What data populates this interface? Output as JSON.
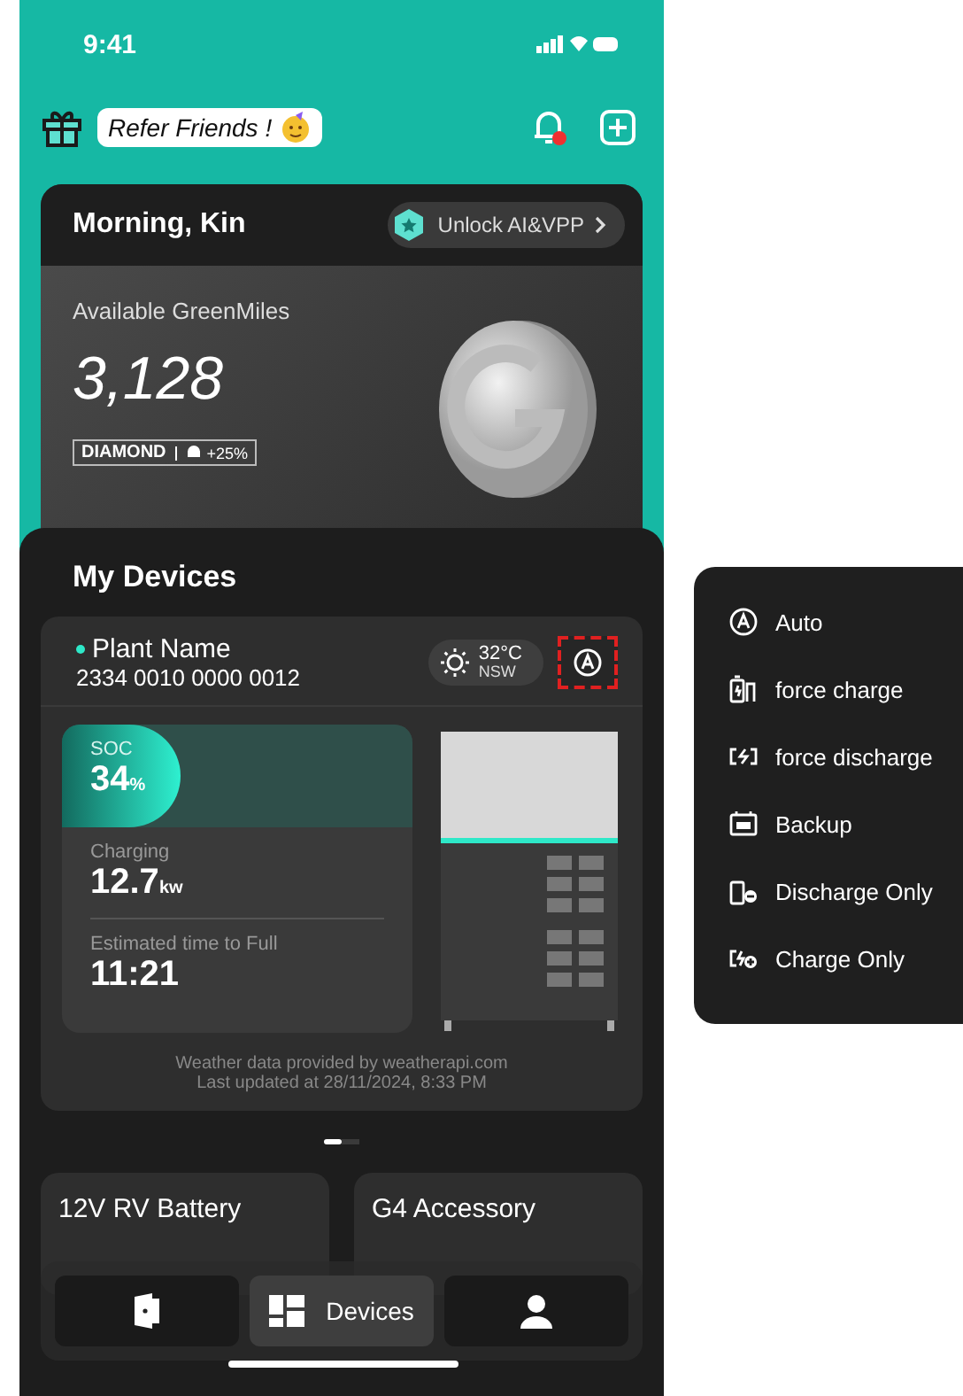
{
  "status_bar": {
    "time": "9:41"
  },
  "header": {
    "refer_label": "Refer Friends !",
    "notifications": {
      "unread": true
    }
  },
  "rewards_card": {
    "greeting": "Morning, Kin",
    "unlock_button": "Unlock AI&VPP",
    "balance_label": "Available GreenMiles",
    "balance": "3,128",
    "tier": "DIAMOND",
    "boost": "+25%"
  },
  "devices": {
    "title": "My Devices",
    "plant": {
      "name": "Plant Name",
      "serial": "2334 0010 0000 0012",
      "online": true,
      "temperature": "32°C",
      "region": "NSW",
      "soc_label": "SOC",
      "soc": "34",
      "soc_unit": "%",
      "level": 0.34,
      "power_label": "Charging",
      "power": "12.7",
      "power_unit": "kw",
      "eta_label": "Estimated time to Full",
      "eta": "11:21",
      "footer": [
        "Weather data provided by weatherapi.com",
        "Last updated at 28/11/2024, 8:33 PM"
      ]
    },
    "pager": [
      {
        "selected": true
      },
      {
        "selected": false
      }
    ],
    "accessories": [
      "12V RV Battery",
      "G4 Accessory"
    ]
  },
  "nav": [
    {
      "kind": "home",
      "selected": false
    },
    {
      "kind": "devices",
      "label": "Devices",
      "selected": true
    },
    {
      "kind": "profile",
      "selected": false
    }
  ],
  "mode_menu": [
    {
      "kind": "auto",
      "label": "Auto"
    },
    {
      "kind": "force_charge",
      "label": "force charge"
    },
    {
      "kind": "force_discharge",
      "label": "force discharge"
    },
    {
      "kind": "backup",
      "label": "Backup"
    },
    {
      "kind": "discharge_only",
      "label": "Discharge Only"
    },
    {
      "kind": "charge_only",
      "label": "Charge Only"
    }
  ]
}
